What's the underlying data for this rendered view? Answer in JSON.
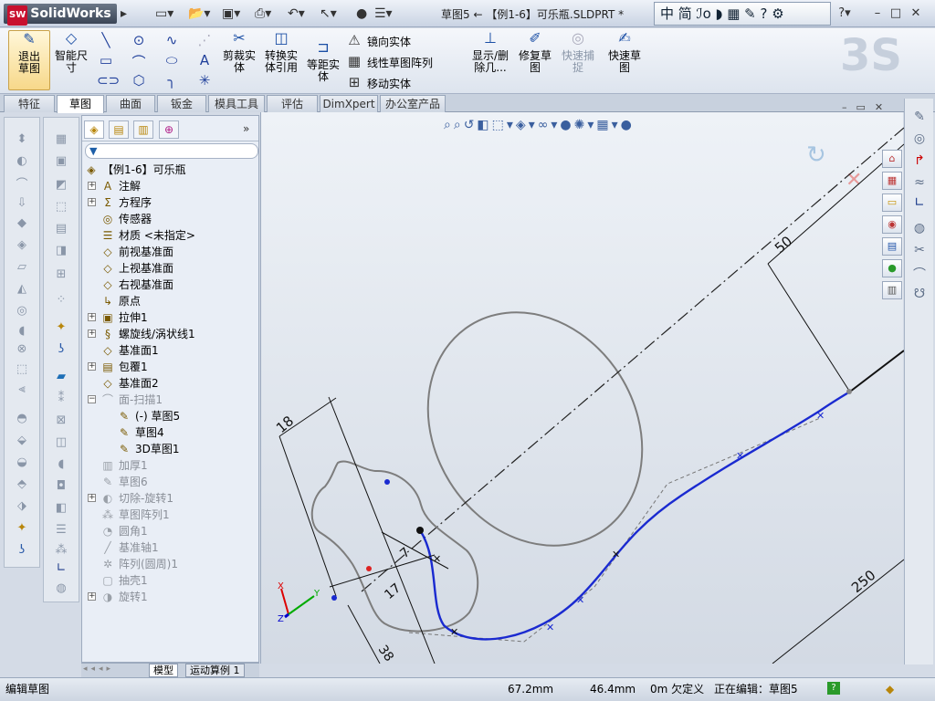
{
  "app": {
    "logo": "SolidWorks",
    "logo_mark": "SW"
  },
  "titlebar": {
    "title": "草图5 ← 【例1-6】可乐瓶.SLDPRT *",
    "ime": "中 简 ℐo ◗ ▦ ✎ ? ⚙"
  },
  "ribbon": {
    "exit_sketch": "退出草图",
    "smart_dim": "智能尺寸",
    "trim": "剪裁实体",
    "convert": "转换实体引用",
    "offset": "等距实体",
    "mirror": "镜向实体",
    "linear_pattern": "线性草图阵列",
    "move": "移动实体",
    "show_delete": "显示/删除几...",
    "repair": "修复草图",
    "quick_snap": "快速捕捉",
    "rapid_sketch": "快速草图"
  },
  "tabs": [
    "特征",
    "草图",
    "曲面",
    "钣金",
    "模具工具",
    "评估",
    "DimXpert",
    "办公室产品"
  ],
  "tree": {
    "filter_icon": "filter-icon",
    "items": [
      {
        "label": "【例1-6】可乐瓶",
        "level": 0,
        "exp": "",
        "icon": "part-icon",
        "glyph": "◈",
        "dim": false
      },
      {
        "label": "注解",
        "level": 1,
        "exp": "+",
        "icon": "annotation-icon",
        "glyph": "A",
        "dim": false
      },
      {
        "label": "方程序",
        "level": 1,
        "exp": "+",
        "icon": "equation-icon",
        "glyph": "Σ",
        "dim": false
      },
      {
        "label": "传感器",
        "level": 1,
        "exp": "",
        "icon": "sensor-icon",
        "glyph": "◎",
        "dim": false
      },
      {
        "label": "材质 <未指定>",
        "level": 1,
        "exp": "",
        "icon": "material-icon",
        "glyph": "☰",
        "dim": false
      },
      {
        "label": "前视基准面",
        "level": 1,
        "exp": "",
        "icon": "plane-icon",
        "glyph": "◇",
        "dim": false
      },
      {
        "label": "上视基准面",
        "level": 1,
        "exp": "",
        "icon": "plane-icon",
        "glyph": "◇",
        "dim": false
      },
      {
        "label": "右视基准面",
        "level": 1,
        "exp": "",
        "icon": "plane-icon",
        "glyph": "◇",
        "dim": false
      },
      {
        "label": "原点",
        "level": 1,
        "exp": "",
        "icon": "origin-icon",
        "glyph": "↳",
        "dim": false
      },
      {
        "label": "拉伸1",
        "level": 1,
        "exp": "+",
        "icon": "extrude-icon",
        "glyph": "▣",
        "dim": false
      },
      {
        "label": "螺旋线/涡状线1",
        "level": 1,
        "exp": "+",
        "icon": "helix-icon",
        "glyph": "§",
        "dim": false
      },
      {
        "label": "基准面1",
        "level": 1,
        "exp": "",
        "icon": "plane-icon",
        "glyph": "◇",
        "dim": false
      },
      {
        "label": "包覆1",
        "level": 1,
        "exp": "+",
        "icon": "wrap-icon",
        "glyph": "▤",
        "dim": false
      },
      {
        "label": "基准面2",
        "level": 1,
        "exp": "",
        "icon": "plane-icon",
        "glyph": "◇",
        "dim": false
      },
      {
        "label": "面-扫描1",
        "level": 1,
        "exp": "−",
        "icon": "sweep-icon",
        "glyph": "⌒",
        "dim": true
      },
      {
        "label": "(-) 草图5",
        "level": 2,
        "exp": "",
        "icon": "sketch-icon",
        "glyph": "✎",
        "dim": false
      },
      {
        "label": "草图4",
        "level": 2,
        "exp": "",
        "icon": "sketch-icon",
        "glyph": "✎",
        "dim": false
      },
      {
        "label": "3D草图1",
        "level": 2,
        "exp": "",
        "icon": "sketch3d-icon",
        "glyph": "✎",
        "dim": false
      },
      {
        "label": "加厚1",
        "level": 1,
        "exp": "",
        "icon": "thicken-icon",
        "glyph": "▥",
        "dim": true
      },
      {
        "label": "草图6",
        "level": 1,
        "exp": "",
        "icon": "sketch-icon",
        "glyph": "✎",
        "dim": true
      },
      {
        "label": "切除-旋转1",
        "level": 1,
        "exp": "+",
        "icon": "cut-revolve-icon",
        "glyph": "◐",
        "dim": true
      },
      {
        "label": "草图阵列1",
        "level": 1,
        "exp": "",
        "icon": "pattern-icon",
        "glyph": "⁂",
        "dim": true
      },
      {
        "label": "圆角1",
        "level": 1,
        "exp": "",
        "icon": "fillet-icon",
        "glyph": "◔",
        "dim": true
      },
      {
        "label": "基准轴1",
        "level": 1,
        "exp": "",
        "icon": "axis-icon",
        "glyph": "╱",
        "dim": true
      },
      {
        "label": "阵列(圆周)1",
        "level": 1,
        "exp": "",
        "icon": "circular-pattern-icon",
        "glyph": "✲",
        "dim": true
      },
      {
        "label": "抽壳1",
        "level": 1,
        "exp": "",
        "icon": "shell-icon",
        "glyph": "▢",
        "dim": true
      },
      {
        "label": "旋转1",
        "level": 1,
        "exp": "+",
        "icon": "revolve-icon",
        "glyph": "◑",
        "dim": true
      }
    ]
  },
  "tree_bottom_tabs": [
    "模型",
    "运动算例 1"
  ],
  "canvas": {
    "dims": [
      "50",
      "18",
      "7",
      "17",
      "38",
      "250"
    ],
    "triad": {
      "x": "X",
      "y": "Y",
      "z": "Z"
    }
  },
  "status": {
    "left": "编辑草图",
    "x": "67.2mm",
    "y": "46.4mm",
    "defined": "0m 欠定义",
    "editing": "正在编辑：草图5",
    "help": "?"
  }
}
